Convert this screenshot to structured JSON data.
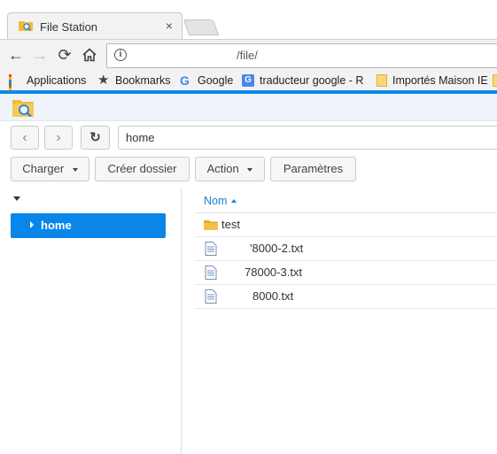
{
  "browser": {
    "tab": {
      "title": "File Station",
      "close": "×"
    },
    "url": "/file/"
  },
  "bookmarks": [
    {
      "label": "Applications",
      "icon": "apps-grid-icon"
    },
    {
      "label": "Bookmarks",
      "icon": "star-icon"
    },
    {
      "label": "Google",
      "icon": "google-icon"
    },
    {
      "label": "traducteur google - R",
      "icon": "translate-icon"
    },
    {
      "label": "Importés Maison IE",
      "icon": "folder-icon"
    }
  ],
  "app": {
    "path": "home",
    "toolbar": {
      "upload_label": "Charger",
      "new_folder_label": "Créer dossier",
      "action_label": "Action",
      "settings_label": "Paramètres"
    },
    "tree": {
      "root_item": "home"
    },
    "list": {
      "column_name": "Nom",
      "items": [
        {
          "name": "test",
          "type": "folder"
        },
        {
          "name": "'8000-2.txt",
          "type": "text-file"
        },
        {
          "name": "78000-3.txt",
          "type": "text-file"
        },
        {
          "name": "8000.txt",
          "type": "text-file"
        }
      ]
    }
  },
  "colors": {
    "accent": "#0a86e8",
    "link": "#1b7fd1",
    "folder": "#f3b93a"
  }
}
